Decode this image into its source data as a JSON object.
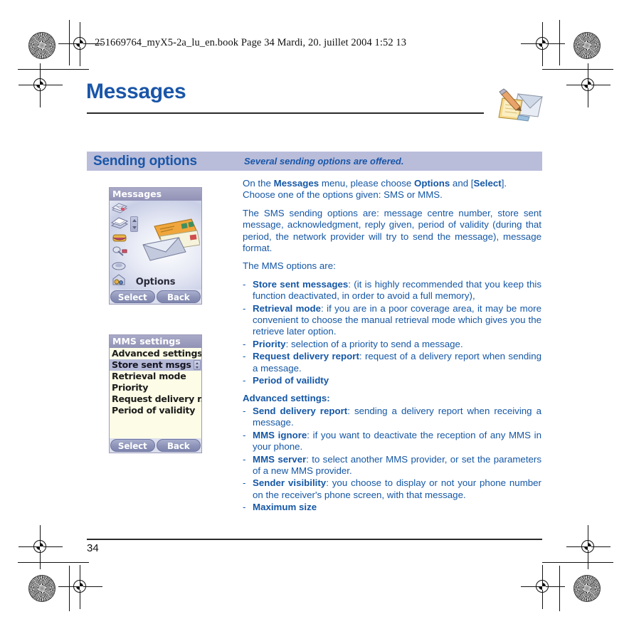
{
  "print_slug": "251669764_myX5-2a_lu_en.book  Page 34  Mardi, 20. juillet 2004  1:52 13",
  "chapter": {
    "title": "Messages",
    "icon": "notepad-pencil-envelope-icon",
    "accent_color": "#1a56a8"
  },
  "section": {
    "title": "Sending options",
    "subtitle": "Several sending options are offered.",
    "band_color": "#b9bdda"
  },
  "body": {
    "intro_line1_a": "On the ",
    "intro_line1_b": "Messages",
    "intro_line1_c": " menu, please choose ",
    "intro_line1_d": "Options",
    "intro_line1_e": " and [",
    "intro_line1_f": "Select",
    "intro_line1_g": "].",
    "intro_line2": "Choose one of the options given: SMS or MMS.",
    "sms_paragraph": "The SMS sending options are: message centre number, store sent message, acknowledgment, reply given, period of validity (during that period, the network provider will try to send the message), message format.",
    "mms_lead": "The MMS options are:",
    "mms_options": [
      {
        "term": "Store sent messages",
        "desc": ": (it is highly recommended that you keep this function deactivated, in order to avoid a full memory),"
      },
      {
        "term": "Retrieval mode",
        "desc": ": if you are in a poor coverage area, it may be more convenient to choose the manual retrieval mode which gives you the retrieve later option."
      },
      {
        "term": "Priority",
        "desc": ": selection of a priority to send a message."
      },
      {
        "term": "Request delivery report",
        "desc": ": request of a delivery report when sending a message."
      },
      {
        "term": "Period of vailidty",
        "desc": ""
      }
    ],
    "advanced_heading": "Advanced settings:",
    "advanced_options": [
      {
        "term": "Send delivery report",
        "desc": ": sending a delivery report when receiving a message."
      },
      {
        "term": "MMS ignore",
        "desc": ": if you want to deactivate the reception of any MMS in your phone."
      },
      {
        "term": "MMS server",
        "desc": ": to select another MMS provider, or set the parameters of a new MMS provider."
      },
      {
        "term": "Sender visibility",
        "desc": ": you choose to display or not your phone number on the receiver's phone screen, with that message."
      },
      {
        "term": "Maximum size",
        "desc": ""
      }
    ],
    "dash": "-"
  },
  "phone_screen_1": {
    "title": "Messages",
    "center_label": "Options",
    "softkey_left": "Select",
    "softkey_right": "Back",
    "icons": [
      "message-stack-icon",
      "open-envelope-icon",
      "drafts-icon",
      "voicemail-icon",
      "outbox-icon",
      "broadcast-icon"
    ],
    "title_bar_color": "#9292b6"
  },
  "phone_screen_2": {
    "title": "MMS settings",
    "items": [
      {
        "label": "Advanced settings",
        "selected": false
      },
      {
        "label": "Store sent msgs",
        "selected": true
      },
      {
        "label": "Retrieval mode",
        "selected": false
      },
      {
        "label": "Priority",
        "selected": false
      },
      {
        "label": "Request delivery r.",
        "selected": false
      },
      {
        "label": "Period of validity",
        "selected": false
      }
    ],
    "softkey_left": "Select",
    "softkey_right": "Back",
    "list_bg_color": "#fdfde7",
    "selected_color": "#b5b9d8"
  },
  "footer": {
    "page_number": "34"
  }
}
